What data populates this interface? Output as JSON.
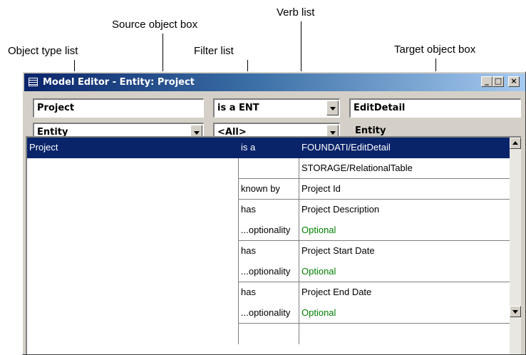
{
  "callouts": {
    "source_object_box": "Source object box",
    "verb_list": "Verb list",
    "object_type_list": "Object type list",
    "filter_list": "Filter list",
    "target_object_box": "Target object box"
  },
  "window": {
    "title": "Model Editor - Entity: Project",
    "minimize_glyph": "_",
    "maximize_glyph": "□",
    "close_glyph": "×"
  },
  "fields": {
    "source_object": "Project",
    "verb": "is a ENT",
    "target_object": "EditDetail",
    "object_type": "Entity",
    "filter": "<All>",
    "target_type": "Entity"
  },
  "grid": {
    "rows": [
      {
        "source": "Project",
        "verb": "is a",
        "target": "FOUNDATI/EditDetail",
        "selected": true
      },
      {
        "source": "",
        "verb": "",
        "target": "STORAGE/RelationalTable"
      },
      {
        "source": "",
        "verb": "known by",
        "target": "Project Id"
      },
      {
        "source": "",
        "verb": "has",
        "target": "Project Description"
      },
      {
        "source": "",
        "verb": "...optionality",
        "target": "Optional"
      },
      {
        "source": "",
        "verb": "has",
        "target": "Project Start Date"
      },
      {
        "source": "",
        "verb": "...optionality",
        "target": "Optional"
      },
      {
        "source": "",
        "verb": "has",
        "target": "Project End Date"
      },
      {
        "source": "",
        "verb": "...optionality",
        "target": "Optional"
      }
    ]
  },
  "colors": {
    "selection": "#0a246a",
    "optional_text": "#008000",
    "window_face": "#d4d0c8"
  },
  "icons": [
    "window-icon",
    "chevron-down-icon",
    "scroll-up-icon",
    "scroll-down-icon"
  ]
}
